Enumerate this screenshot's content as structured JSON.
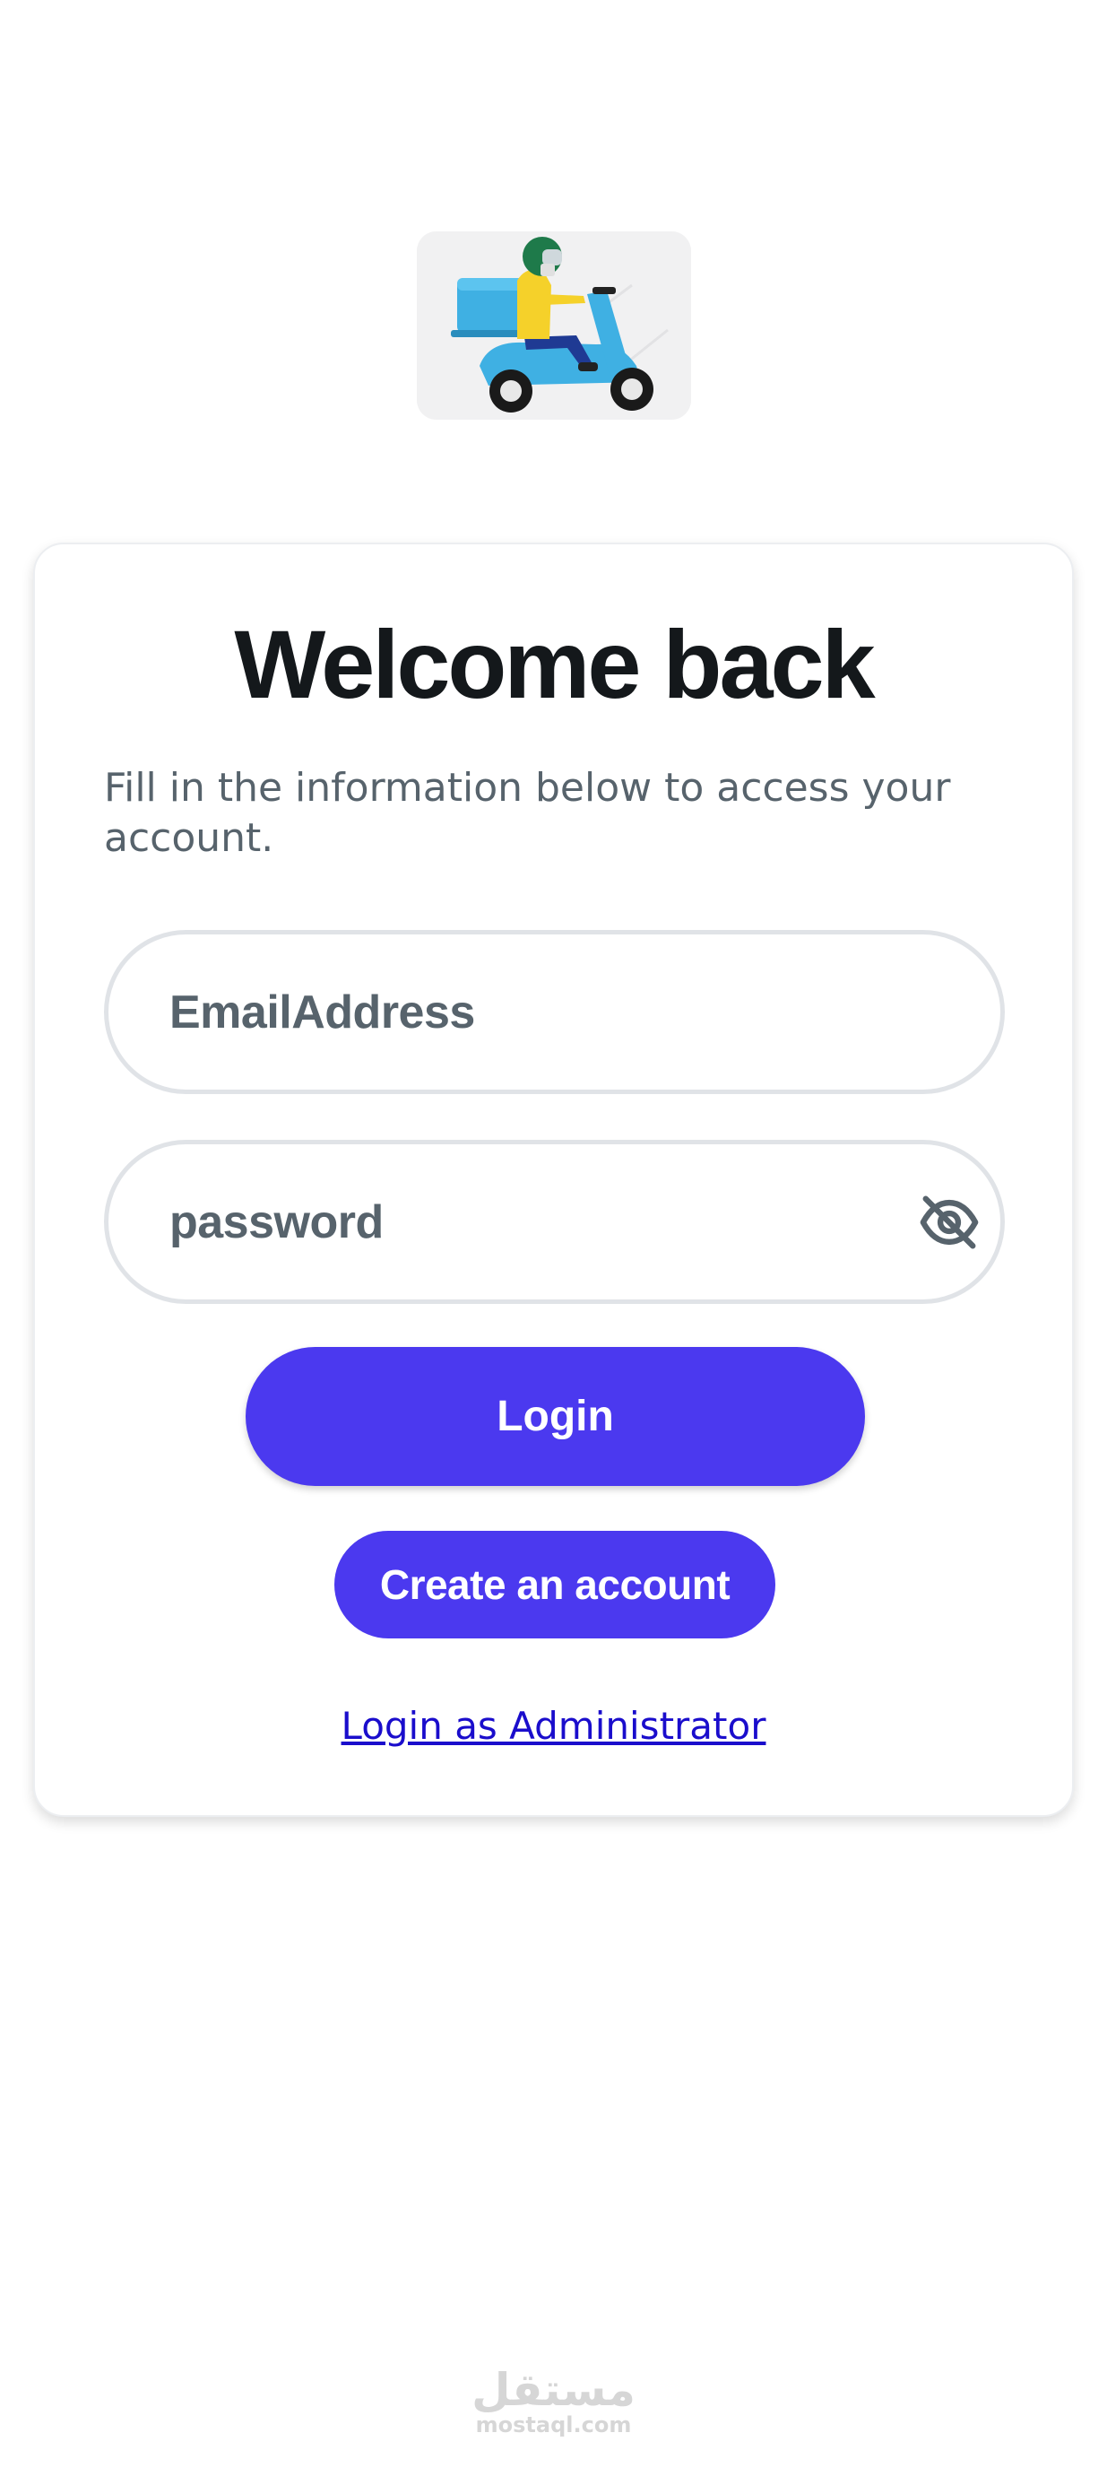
{
  "logo": {
    "icon": "delivery-scooter-icon",
    "colors": {
      "background": "#f1f1f2",
      "scooter": "#3fb0e3",
      "jacket": "#f5d12a",
      "helmet": "#1e7a4a",
      "pants": "#1f3a93"
    }
  },
  "login_card": {
    "title": "Welcome back",
    "subtitle": "Fill in the information below to access your account.",
    "email_field": {
      "placeholder": "EmailAddress"
    },
    "password_field": {
      "placeholder": "password",
      "visibility_icon": "eye-off-icon"
    },
    "login_button_label": "Login",
    "create_account_button_label": "Create an account",
    "admin_link_label": "Login as Administrator"
  },
  "theme": {
    "primary": "#4b39ef",
    "secondary_text": "#57636c",
    "primary_text": "#14181b",
    "link": "#1a0dcc"
  },
  "watermark": {
    "arabic": "مستقل",
    "latin": "mostaql.com"
  }
}
